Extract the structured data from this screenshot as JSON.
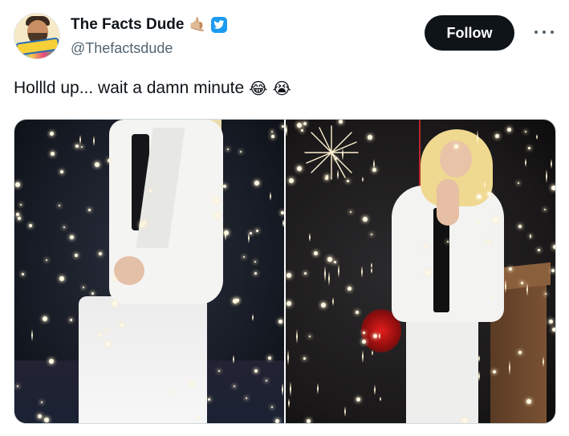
{
  "author": {
    "display_name": "The Facts Dude",
    "handle": "@Thefactsdude",
    "avatar_badge_text": "The FACTS Dude",
    "name_emoji": "🤙🏼",
    "verified_icon": "verified-badge-icon"
  },
  "actions": {
    "follow_label": "Follow",
    "more_icon": "more-horizontal-icon"
  },
  "tweet": {
    "text": "Hollld up... wait a damn minute",
    "emojis": [
      "😂",
      "😭"
    ]
  },
  "media": {
    "count": 2,
    "photos": [
      {
        "name": "photo-1"
      },
      {
        "name": "photo-2"
      }
    ]
  },
  "colors": {
    "follow_bg": "#0f1419",
    "verified": "#1d9bf0",
    "handle_text": "#536471"
  }
}
